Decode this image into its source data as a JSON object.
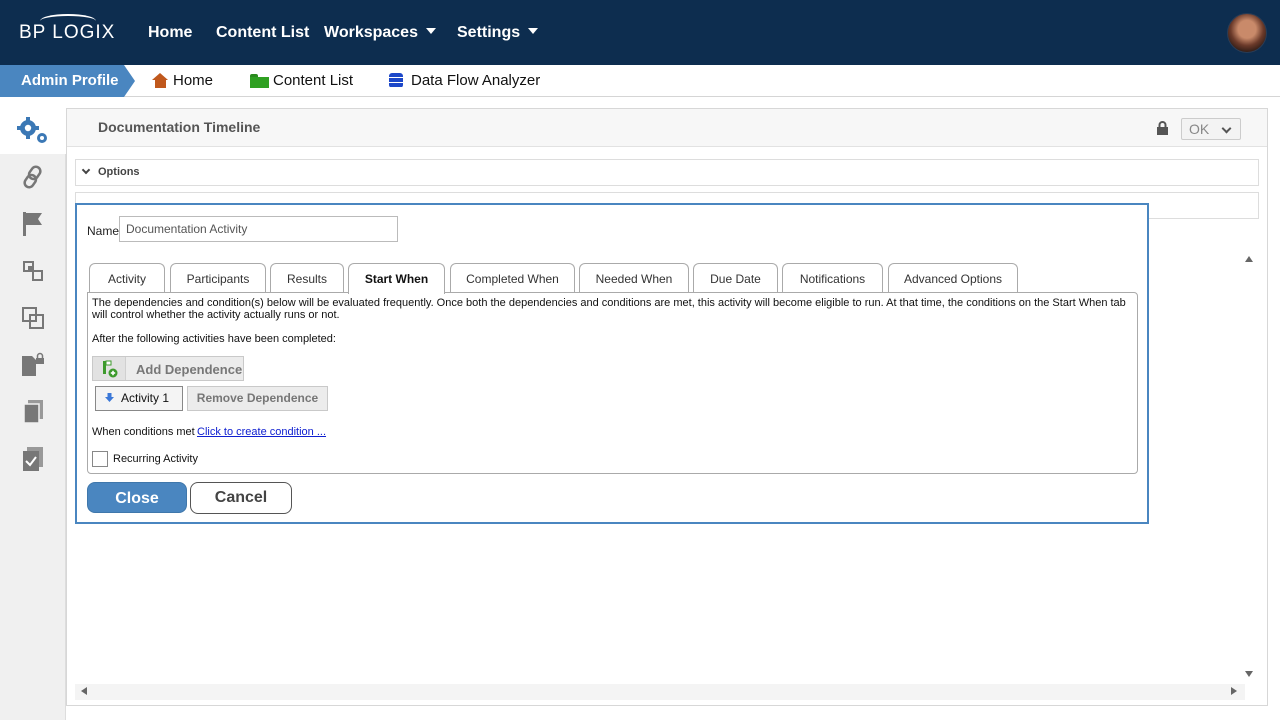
{
  "topnav": {
    "logo_text": "BP LOGIX",
    "items": [
      {
        "label": "Home"
      },
      {
        "label": "Content List"
      },
      {
        "label": "Workspaces"
      },
      {
        "label": "Settings"
      }
    ]
  },
  "breadcrumb": {
    "admin_label": "Admin Profile",
    "items": [
      {
        "label": "Home",
        "icon": "home-icon"
      },
      {
        "label": "Content List",
        "icon": "folder-icon"
      },
      {
        "label": "Data Flow Analyzer",
        "icon": "database-icon"
      }
    ]
  },
  "sidebar": {
    "items": [
      {
        "icon": "gears-icon"
      },
      {
        "icon": "link-icon"
      },
      {
        "icon": "flag-icon"
      },
      {
        "icon": "nodes-icon"
      },
      {
        "icon": "layers-icon"
      },
      {
        "icon": "locked-document-icon"
      },
      {
        "icon": "documents-icon"
      },
      {
        "icon": "checklist-icon"
      }
    ]
  },
  "main": {
    "title": "Documentation Timeline",
    "ok_label": "OK",
    "options_label": "Options"
  },
  "dialog": {
    "name_label": "Name",
    "name_value": "Documentation Activity",
    "tabs": [
      {
        "label": "Activity"
      },
      {
        "label": "Participants"
      },
      {
        "label": "Results"
      },
      {
        "label": "Start When"
      },
      {
        "label": "Completed When"
      },
      {
        "label": "Needed When"
      },
      {
        "label": "Due Date"
      },
      {
        "label": "Notifications"
      },
      {
        "label": "Advanced Options"
      }
    ],
    "active_tab": "Start When",
    "description": "The dependencies and condition(s) below will be evaluated frequently. Once both the dependencies and conditions are met, this activity will become eligible to run. At that time, the conditions on the Start When tab will control whether the activity actually runs or not.",
    "after_text": "After the following activities have been completed:",
    "add_dependence_label": "Add Dependence",
    "dependency_item": "Activity 1",
    "remove_dependence_label": "Remove Dependence",
    "when_conditions_label": "When conditions met",
    "create_condition_link": "Click to create condition ...",
    "recurring_label": "Recurring Activity",
    "recurring_checked": false,
    "close_label": "Close",
    "cancel_label": "Cancel"
  },
  "colors": {
    "topnav_bg": "#0d2d4f",
    "accent": "#4a86c0",
    "link": "#1020d0"
  }
}
